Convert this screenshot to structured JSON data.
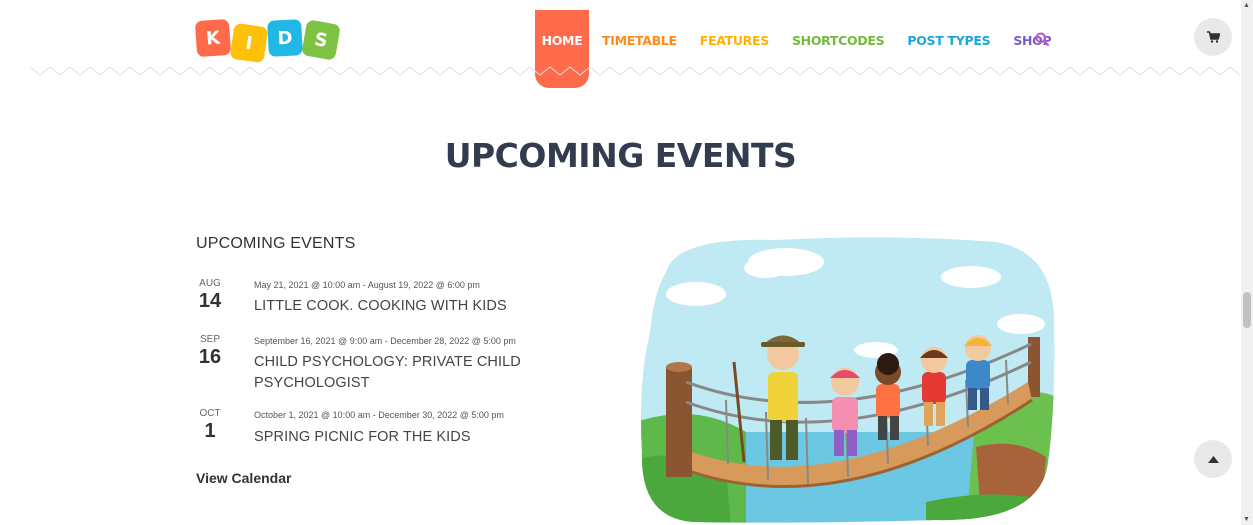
{
  "logo": {
    "letters": [
      "K",
      "I",
      "D",
      "S"
    ]
  },
  "nav": {
    "items": [
      {
        "label": "HOME",
        "color": "#ff6b4a"
      },
      {
        "label": "TIMETABLE",
        "color": "#ff8c1a"
      },
      {
        "label": "FEATURES",
        "color": "#ffb300"
      },
      {
        "label": "SHORTCODES",
        "color": "#76b83f"
      },
      {
        "label": "POST TYPES",
        "color": "#1aa6e0"
      },
      {
        "label": "SHOP",
        "color": "#7a5cc9"
      }
    ],
    "search_icon": "search-icon",
    "cart_icon": "cart-icon"
  },
  "page": {
    "title": "UPCOMING EVENTS"
  },
  "events_widget": {
    "title": "UPCOMING EVENTS",
    "events": [
      {
        "month": "AUG",
        "day": "14",
        "dates": "May 21, 2021 @ 10:00 am - August 19, 2022 @ 6:00 pm",
        "title": "LITTLE COOK. COOKING WITH KIDS"
      },
      {
        "month": "SEP",
        "day": "16",
        "dates": "September 16, 2021 @ 9:00 am - December 28, 2022 @ 5:00 pm",
        "title": "CHILD PSYCHOLOGY: PRIVATE CHILD PSYCHOLOGIST"
      },
      {
        "month": "OCT",
        "day": "1",
        "dates": "October 1, 2021 @ 10:00 am - December 30, 2022 @ 5:00 pm",
        "title": "SPRING PICNIC FOR THE KIDS"
      }
    ],
    "view_calendar": "View Calendar"
  },
  "illustration": {
    "name": "kids-on-rope-bridge-illustration"
  },
  "back_to_top_icon": "chevron-up-icon",
  "colors": {
    "accent": "#ff6b4a",
    "heading": "#333c4e"
  }
}
